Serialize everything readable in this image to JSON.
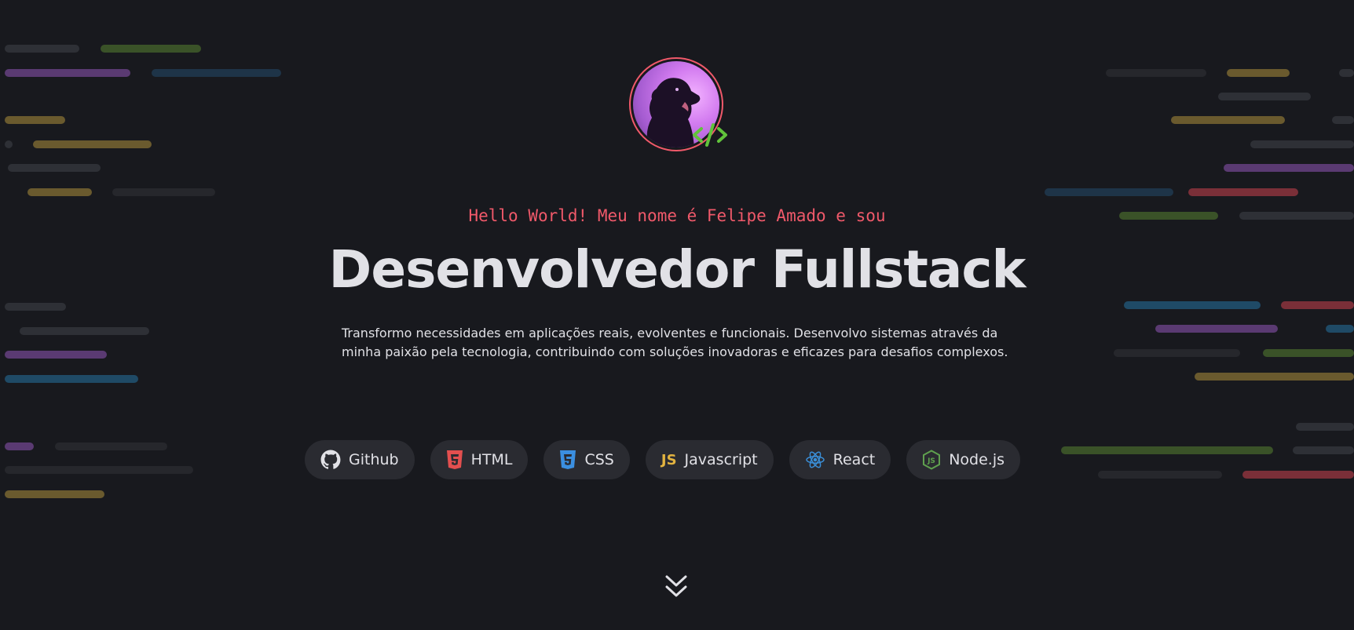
{
  "hero": {
    "greeting": "Hello World! Meu nome é Felipe Amado e sou",
    "title": "Desenvolvedor Fullstack",
    "description_line1": "Transformo necessidades em aplicações reais, evolventes e funcionais. Desenvolvo sistemas através da",
    "description_line2": "minha paixão pela tecnologia, contribuindo com soluções inovadoras e eficazes para desafios complexos."
  },
  "techs": [
    {
      "label": "Github",
      "icon": "github-icon",
      "color": "#e1e1e6"
    },
    {
      "label": "HTML",
      "icon": "html5-icon",
      "color": "#e34f4f"
    },
    {
      "label": "CSS",
      "icon": "css3-icon",
      "color": "#3b8fe0"
    },
    {
      "label": "Javascript",
      "icon": "js-icon",
      "icon_text": "JS",
      "color": "#e2b340"
    },
    {
      "label": "React",
      "icon": "react-icon",
      "color": "#3a8fd8"
    },
    {
      "label": "Node.js",
      "icon": "nodejs-icon",
      "color": "#5fa04e"
    }
  ],
  "colors": {
    "background": "#18191e",
    "accent": "#f0596a",
    "text": "#e1e1e6",
    "badge": "#2a2b31",
    "code_badge": "#61c33b"
  },
  "icons": {
    "avatar_badge": "code-brackets-icon",
    "scroll": "double-chevron-down-icon"
  }
}
